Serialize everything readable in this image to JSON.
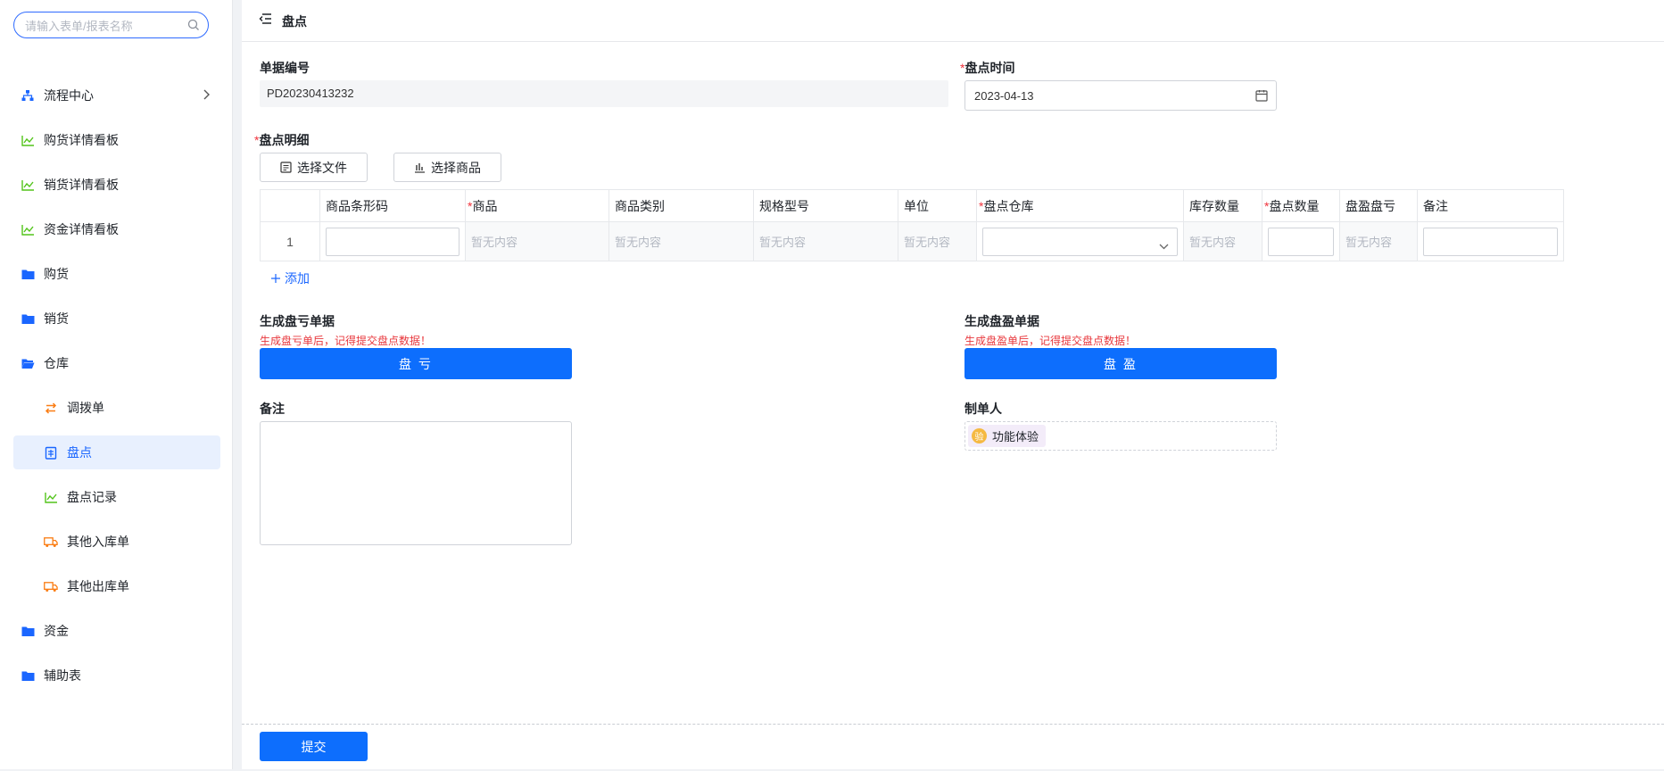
{
  "search": {
    "placeholder": "请输入表单/报表名称"
  },
  "sidebar": {
    "items": [
      {
        "label": "流程中心"
      },
      {
        "label": "购货详情看板"
      },
      {
        "label": "销货详情看板"
      },
      {
        "label": "资金详情看板"
      },
      {
        "label": "购货"
      },
      {
        "label": "销货"
      },
      {
        "label": "仓库"
      },
      {
        "label": "调拨单"
      },
      {
        "label": "盘点"
      },
      {
        "label": "盘点记录"
      },
      {
        "label": "其他入库单"
      },
      {
        "label": "其他出库单"
      },
      {
        "label": "资金"
      },
      {
        "label": "辅助表"
      }
    ]
  },
  "header": {
    "title": "盘点"
  },
  "form": {
    "doc_no_label": "单据编号",
    "doc_no_value": "PD20230413232",
    "time_label": "盘点时间",
    "time_value": "2023-04-13",
    "detail_label": "盘点明细",
    "select_file": "选择文件",
    "select_goods": "选择商品",
    "columns": [
      "商品条形码",
      "商品",
      "商品类别",
      "规格型号",
      "单位",
      "盘点仓库",
      "库存数量",
      "盘点数量",
      "盘盈盘亏",
      "备注"
    ],
    "row_index": "1",
    "empty_text": "暂无内容",
    "add_label": "添加",
    "loss_label": "生成盘亏单据",
    "loss_tip": "生成盘亏单后，记得提交盘点数据！",
    "loss_btn": "盘 亏",
    "gain_label": "生成盘盈单据",
    "gain_tip": "生成盘盈单后，记得提交盘点数据！",
    "gain_btn": "盘 盈",
    "remark_label": "备注",
    "maker_label": "制单人",
    "maker_avatar": "验",
    "maker_name": "功能体验"
  },
  "footer": {
    "submit": "提交"
  },
  "colors": {
    "accent": "#0d6efd",
    "required": "#f0323c",
    "tip": "#e8383d",
    "icon_green": "#52c41a",
    "icon_orange": "#fa7d14",
    "folder_blue": "#1a66ff"
  }
}
